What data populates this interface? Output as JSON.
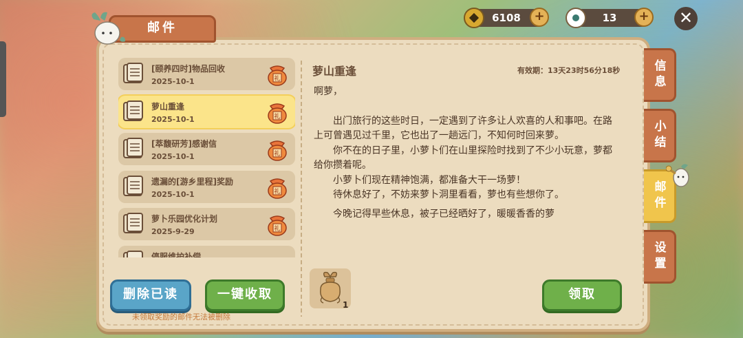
{
  "header": {
    "title": "邮件"
  },
  "currency": {
    "coins": "6108",
    "gems": "13"
  },
  "mails": [
    {
      "title": "[颐养四时]物品回收",
      "date": "2025-10-1",
      "selected": false
    },
    {
      "title": "萝山重逢",
      "date": "2025-10-1",
      "selected": true
    },
    {
      "title": "[萃馥研芳]感谢信",
      "date": "2025-10-1",
      "selected": false
    },
    {
      "title": "遗漏的[游乡里程]奖励",
      "date": "2025-10-1",
      "selected": false
    },
    {
      "title": "萝卜乐园优化计划",
      "date": "2025-9-29",
      "selected": false
    },
    {
      "title": "停服维护补偿",
      "date": "",
      "selected": false
    }
  ],
  "buttons": {
    "delete_read": "删除已读",
    "collect_all": "一键收取",
    "claim": "领取"
  },
  "hint": "未领取奖励的邮件无法被删除",
  "letter": {
    "title": "萝山重逢",
    "validity": "有效期：13天23时56分18秒",
    "greeting": "啊萝，",
    "paragraphs": [
      "出门旅行的这些时日，一定遇到了许多让人欢喜的人和事吧。在路上可曾遇见过千里，它也出了一趟远门，不知何时回来萝。",
      "你不在的日子里，小萝卜们在山里探险时找到了不少小玩意，萝都给你攒着呢。",
      "小萝卜们现在精神饱满，都准备大干一场萝！",
      "待休息好了，不妨来萝卜洞里看看，萝也有些想你了。",
      "今晚记得早些休息，被子已经晒好了，暖暖香香的萝"
    ]
  },
  "reward": {
    "count": "1"
  },
  "side_tabs": [
    {
      "label": "信息",
      "active": false
    },
    {
      "label": "小结",
      "active": false
    },
    {
      "label": "邮件",
      "active": true
    },
    {
      "label": "设置",
      "active": false
    }
  ]
}
